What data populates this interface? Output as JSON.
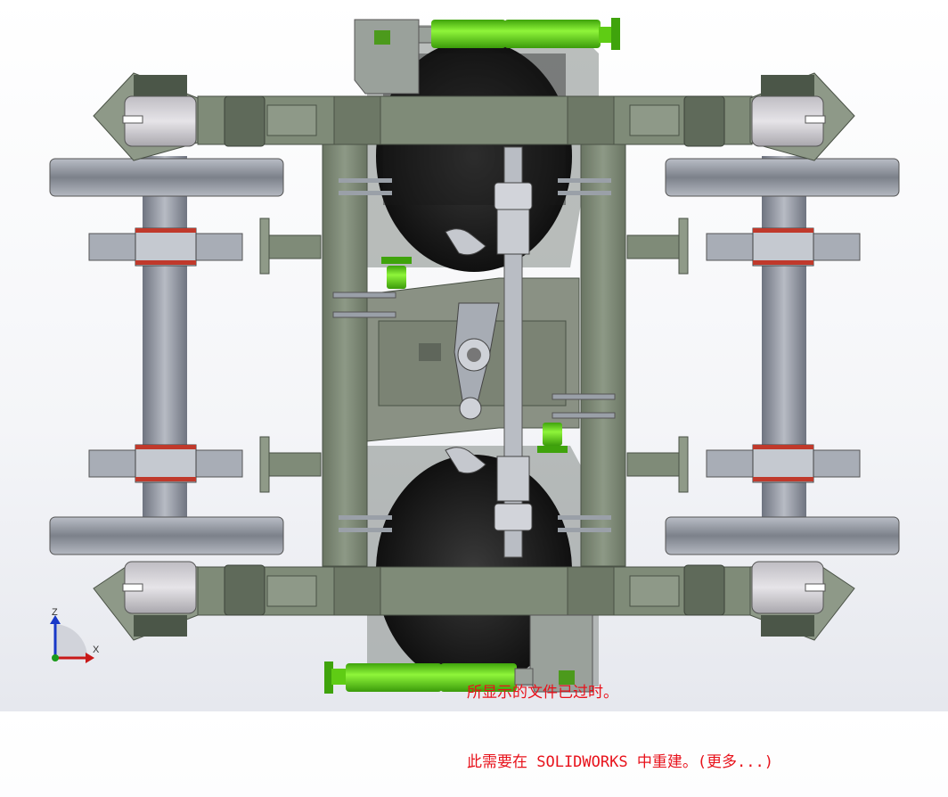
{
  "viewport": {
    "status_message": {
      "line1": "所显示的文件已过时。",
      "line2": "此需要在 SOLIDWORKS 中重建。(更多...)"
    },
    "triad": {
      "z_label": "Z",
      "x_label": "X"
    }
  },
  "colors": {
    "background": "#ffffff",
    "frame": "#7f8b78",
    "frame_dark": "#5a6457",
    "tire": "#1c1c1c",
    "damper_green": "#6ee31a",
    "wheel_gray": "#9ea3ad",
    "bearing_light": "#d3d1d6",
    "red_ring": "#c0392b",
    "message_red": "#e8121b"
  }
}
